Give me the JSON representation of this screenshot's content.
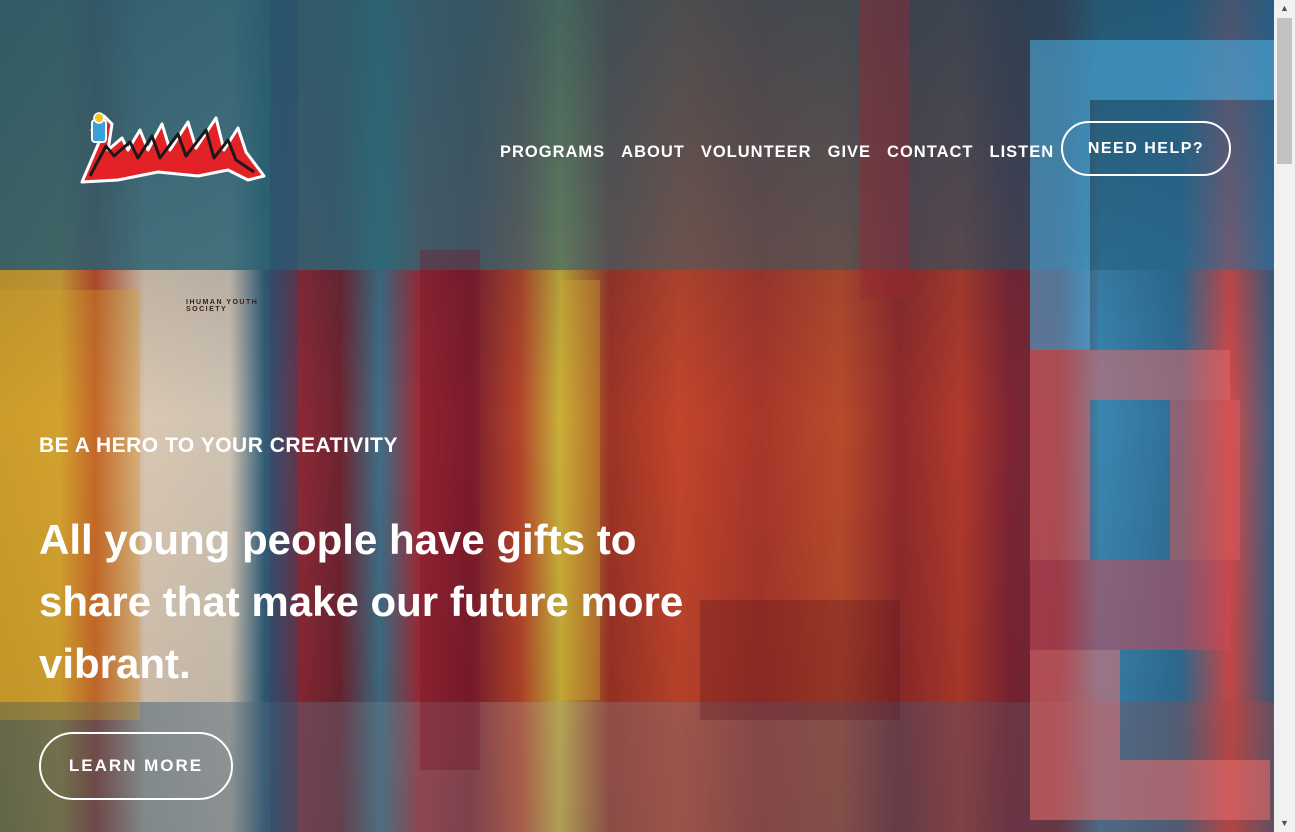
{
  "logo": {
    "alt": "IHuman",
    "caption": "IHUMAN YOUTH SOCIETY",
    "icon": "ihuman-graffiti-logo-icon"
  },
  "nav": {
    "items": [
      {
        "label": "PROGRAMS"
      },
      {
        "label": "ABOUT"
      },
      {
        "label": "VOLUNTEER"
      },
      {
        "label": "GIVE"
      },
      {
        "label": "CONTACT"
      },
      {
        "label": "LISTEN"
      }
    ],
    "help_button": "NEED HELP?"
  },
  "hero": {
    "eyebrow": "BE A HERO TO YOUR CREATIVITY",
    "headline": "All young people have gifts to share that make our future more vibrant.",
    "cta": "LEARN MORE"
  },
  "colors": {
    "text": "#ffffff",
    "logo_red": "#e32227",
    "watermark_blue": "#4fb3e6"
  }
}
